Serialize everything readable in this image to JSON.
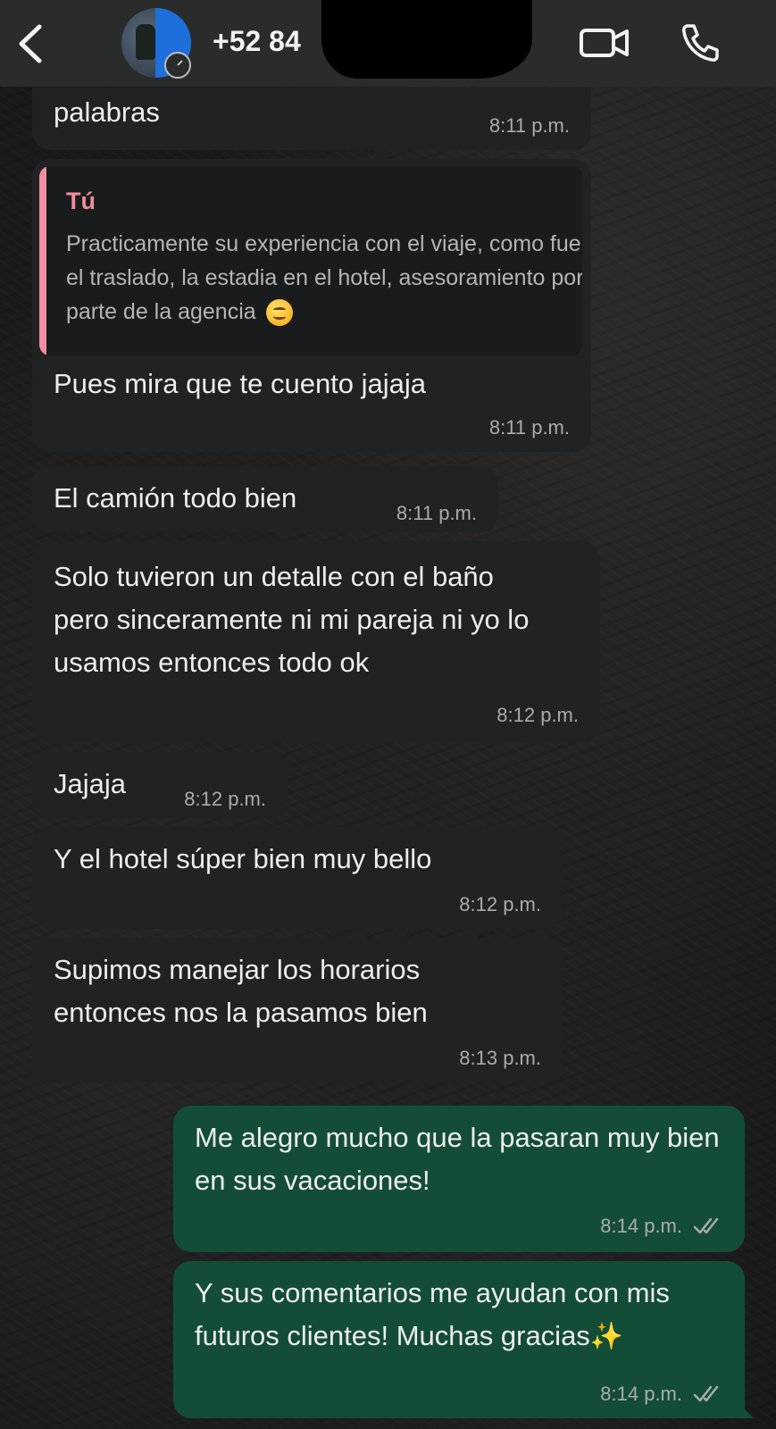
{
  "header": {
    "contact_name": "+52 84",
    "icons": [
      "back-chevron-icon",
      "video-camera-icon",
      "phone-icon"
    ]
  },
  "messages": [
    {
      "direction": "in",
      "text": "palabras",
      "time": "8:11 p.m."
    },
    {
      "direction": "in",
      "quote_author": "Tú",
      "quote_text": "Practicamente su experiencia con el viaje, como fue el traslado, la estadia en el hotel, asesoramiento por parte de la agencia",
      "quote_emoji": "smiling-face-emoji",
      "text": "Pues mira que te cuento jajaja",
      "time": "8:11 p.m."
    },
    {
      "direction": "in",
      "text": "El camión todo bien",
      "time": "8:11 p.m."
    },
    {
      "direction": "in",
      "text": "Solo tuvieron un detalle con el baño pero sinceramente ni mi pareja ni yo lo usamos entonces todo ok",
      "time": "8:12 p.m."
    },
    {
      "direction": "in",
      "text": "Jajaja",
      "time": "8:12 p.m."
    },
    {
      "direction": "in",
      "text": "Y el hotel súper bien muy bello",
      "time": "8:12 p.m."
    },
    {
      "direction": "in",
      "text": "Supimos manejar los horarios entonces nos la pasamos bien",
      "time": "8:13 p.m."
    },
    {
      "direction": "out",
      "text": "Me alegro mucho que la pasaran muy bien en sus vacaciones!",
      "time": "8:14 p.m.",
      "status": "read"
    },
    {
      "direction": "out",
      "text": "Y sus comentarios me ayudan con mis futuros clientes! Muchas gracias",
      "text_emoji": "✨",
      "time": "8:14 p.m.",
      "status": "read"
    }
  ],
  "colors": {
    "incoming_bubble": "#202223",
    "outgoing_bubble": "#144d37",
    "quote_accent": "#f28ca0",
    "timestamp": "#a9acad"
  }
}
